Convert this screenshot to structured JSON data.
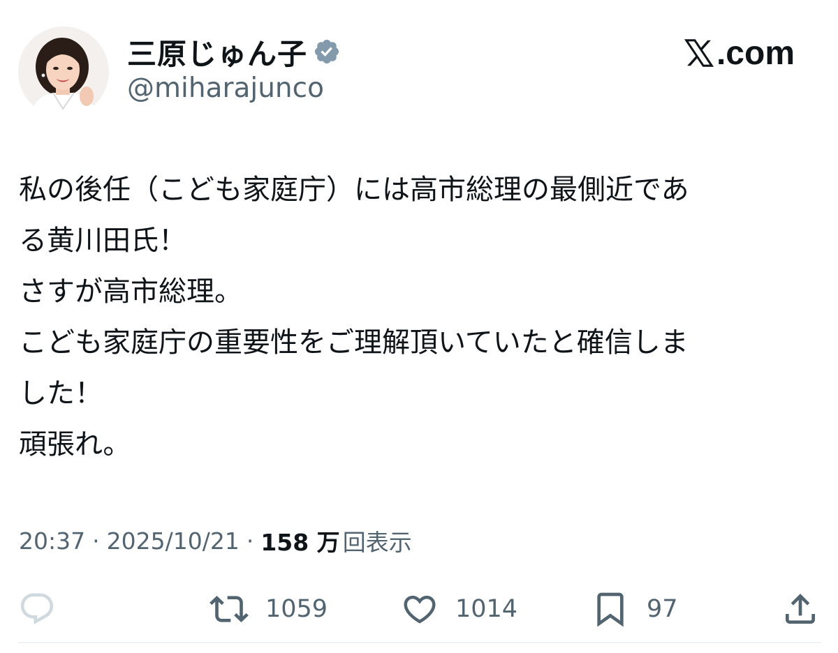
{
  "author": {
    "display_name": "三原じゅん子",
    "handle": "@miharajunco",
    "verified_icon": "verified-badge-icon",
    "avatar_icon": "profile-photo"
  },
  "site": {
    "logo_text": ".com",
    "logo_icon": "x-logo-icon"
  },
  "post": {
    "lines": [
      "私の後任（こども家庭庁）には高市総理の最側近であ",
      "る黄川田氏！",
      "さすが高市総理。",
      "こども家庭庁の重要性をご理解頂いていたと確信しま",
      "した！",
      "頑張れ。"
    ]
  },
  "meta": {
    "time": "20:37",
    "separator": "·",
    "date": "2025/10/21",
    "views_count": "158 万",
    "views_label": "回表示"
  },
  "actions": {
    "reply": {
      "icon": "reply-icon"
    },
    "repost": {
      "icon": "repost-icon",
      "count": "1059"
    },
    "like": {
      "icon": "heart-icon",
      "count": "1014"
    },
    "bookmark": {
      "icon": "bookmark-icon",
      "count": "97"
    },
    "share": {
      "icon": "share-icon"
    }
  },
  "colors": {
    "text_primary": "#0f1419",
    "text_secondary": "#536471",
    "verified": "#829aab",
    "divider": "#eff3f4"
  }
}
